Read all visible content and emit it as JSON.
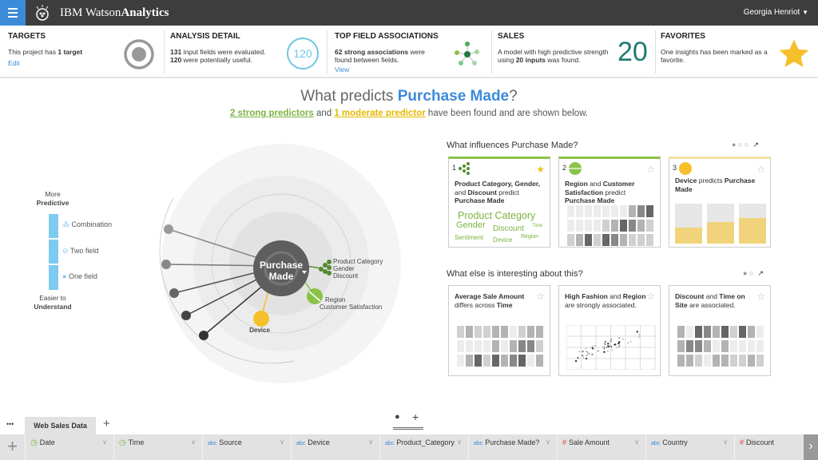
{
  "topbar": {
    "brand_light": "IBM Watson",
    "brand_bold": "Analytics",
    "user": "Georgia Henriot",
    "user_caret": "▼"
  },
  "summary": {
    "targets": {
      "heading": "TARGETS",
      "text_pre": "This project has ",
      "text_bold": "1 target",
      "link": "Edit"
    },
    "analysis": {
      "heading": "ANALYSIS DETAIL",
      "l1_bold": "131",
      "l1": " input fields were evaluated.",
      "l2_bold": "120",
      "l2": " were potentially useful.",
      "badge": "120"
    },
    "associations": {
      "heading": "TOP FIELD ASSOCIATIONS",
      "bold": "62 strong associations",
      "text": " were found between fields.",
      "link": "View"
    },
    "sales": {
      "heading": "SALES",
      "pre": "A model with high predictive strength using ",
      "bold": "20 inputs",
      "post": " was found.",
      "big": "20"
    },
    "favorites": {
      "heading": "FAVORITES",
      "text": "One insights has been marked as a favorite."
    }
  },
  "question": {
    "pre": "What predicts ",
    "target": "Purchase Made",
    "post": "?"
  },
  "subtitle": {
    "strong": "2 strong predictors",
    "mid": " and ",
    "moderate": "1 moderate predictor",
    "post": " have been found and are shown below."
  },
  "legend": {
    "top_light": "More",
    "top_bold": "Predictive",
    "items": [
      "Combination",
      "Two field",
      "One field"
    ],
    "bottom_light": "Easier to",
    "bottom_bold": "Understand"
  },
  "spiral": {
    "center_l1": "Purchase",
    "center_l2": "Made",
    "combo_labels": [
      "Product Category",
      "Gender",
      "Discount"
    ],
    "two_labels": [
      "Region",
      "Customer Satisfaction"
    ],
    "one_label": "Device"
  },
  "influences": {
    "title_pre": "What influences ",
    "title_bold": "Purchase Made?",
    "cards": [
      {
        "num": "1",
        "title_html": "<b>Product Category, Gender,</b> and <b>Discount</b> predict <b>Purchase Made</b>",
        "words": [
          "Product Category",
          "Gender",
          "Discount",
          "Time",
          "Sentiment",
          "Device",
          "Region"
        ]
      },
      {
        "num": "2",
        "title_html": "<b>Region</b> and <b>Customer Satisfaction</b> predict <b>Purchase Made</b>"
      },
      {
        "num": "3",
        "title_html": "<b>Device</b> predicts <b>Purchase Made</b>",
        "bars": [
          0.4,
          0.55,
          0.65
        ]
      }
    ]
  },
  "interesting": {
    "title": "What else is interesting about this?",
    "cards": [
      {
        "title_html": "<b>Average Sale Amount</b> differs across <b>Time</b>"
      },
      {
        "title_html": "<b>High Fashion</b> and <b>Region</b> are strongly associated."
      },
      {
        "title_html": "<b>Discount</b> and <b>Time on Site</b> are associated."
      }
    ]
  },
  "tabs": {
    "more": "•••",
    "active": "Web Sales Data",
    "add": "+"
  },
  "columns": [
    {
      "type": "time",
      "label": "Date"
    },
    {
      "type": "time",
      "label": "Time"
    },
    {
      "type": "abc",
      "label": "Source"
    },
    {
      "type": "abc",
      "label": "Device"
    },
    {
      "type": "abc",
      "label": "Product_Category"
    },
    {
      "type": "abc",
      "label": "Purchase Made?"
    },
    {
      "type": "num",
      "label": "Sale Amount"
    },
    {
      "type": "abc",
      "label": "Country"
    },
    {
      "type": "num",
      "label": "Discount"
    }
  ],
  "colors": {
    "accent": "#3b8bd9",
    "green": "#7cb342",
    "dark_green": "#558b2f",
    "yellow": "#f5c02a",
    "teal": "#1e7a70"
  }
}
